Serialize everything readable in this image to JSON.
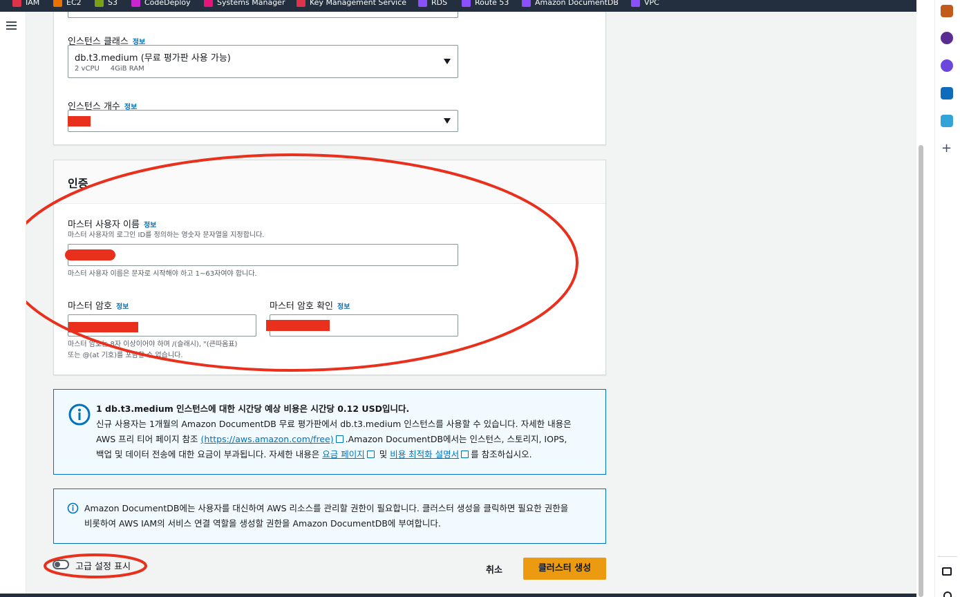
{
  "bookmarks": [
    {
      "label": "IAM",
      "color": "#dd344c"
    },
    {
      "label": "EC2",
      "color": "#ed7100"
    },
    {
      "label": "S3",
      "color": "#7aa116"
    },
    {
      "label": "CodeDeploy",
      "color": "#c925d1"
    },
    {
      "label": "Systems Manager",
      "color": "#e7157b"
    },
    {
      "label": "Key Management Service",
      "color": "#dd344c"
    },
    {
      "label": "RDS",
      "color": "#8c4fff"
    },
    {
      "label": "Route 53",
      "color": "#8c4fff"
    },
    {
      "label": "Amazon DocumentDB",
      "color": "#8c4fff"
    },
    {
      "label": "VPC",
      "color": "#8c4fff"
    }
  ],
  "info_link": "정보",
  "instance": {
    "class_label": "인스턴스 클래스",
    "class_value": "db.t3.medium (무료 평가판 사용 가능)",
    "class_detail_vcpu": "2 vCPU",
    "class_detail_ram": "4GiB RAM",
    "count_label": "인스턴스 개수"
  },
  "auth": {
    "title": "인증",
    "username_label": "마스터 사용자 이름",
    "username_desc": "마스터 사용자의 로그인 ID를 정의하는 영숫자 문자열을 지정합니다.",
    "username_hint": "마스터 사용자 이름은 문자로 시작해야 하고 1~63자여야 합니다.",
    "password_label": "마스터 암호",
    "password_confirm_label": "마스터 암호 확인",
    "password_hint_line1": "마스터 암호는 8자 이상이어야 하며 /(슬래시), \"(큰따옴표)",
    "password_hint_line2": "또는 @(at 기호)를 포함할 수 없습니다."
  },
  "cost_alert": {
    "title": "1 db.t3.medium 인스턴스에 대한 시간당 예상 비용은 시간당 0.12 USD입니다.",
    "line1": "신규 사용자는 1개월의 Amazon DocumentDB 무료 평가판에서 db.t3.medium 인스턴스를 사용할 수 있습니다. 자세한 내용은",
    "line2_prefix": "AWS 프리 티어 페이지 참조 ",
    "line2_link": "(https://aws.amazon.com/free)",
    "line2_suffix": ".Amazon DocumentDB에서는 인스턴스, 스토리지, IOPS,",
    "line3_prefix": "백업 및 데이터 전송에 대한 요금이 부과됩니다. 자세한 내용은 ",
    "line3_link1": "요금 페이지",
    "line3_mid": " 및 ",
    "line3_link2": "비용 최적화 설명서",
    "line3_suffix": "를 참조하십시오."
  },
  "permission_alert": {
    "line1": "Amazon DocumentDB에는 사용자를 대신하여 AWS 리소스를 관리할 권한이 필요합니다. 클러스터 생성을 클릭하면 필요한 권한을",
    "line2": "비롯하여 AWS IAM의 서비스 연결 역할을 생성할 권한을 Amazon DocumentDB에 부여합니다."
  },
  "footer": {
    "advanced_toggle_label": "고급 설정 표시",
    "advanced_toggle_on": false,
    "cancel": "취소",
    "create": "클러스터 생성"
  },
  "colors": {
    "annotation": "#e8301d",
    "primary_button": "#ec9a0f",
    "link": "#0073bb"
  }
}
